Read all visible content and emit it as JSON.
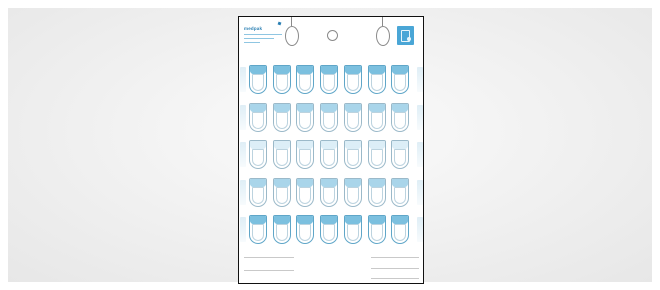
{
  "document": {
    "brand": "medpak",
    "days": [
      "",
      "",
      "",
      "",
      "",
      "",
      ""
    ],
    "rows": [
      {
        "style": "strong"
      },
      {
        "style": "mid"
      },
      {
        "style": "light"
      },
      {
        "style": "mid"
      },
      {
        "style": "strong"
      }
    ],
    "colors": {
      "accent": "#4aa6d6",
      "pill_border": "#9bb9c9",
      "frame": "#111111"
    }
  }
}
